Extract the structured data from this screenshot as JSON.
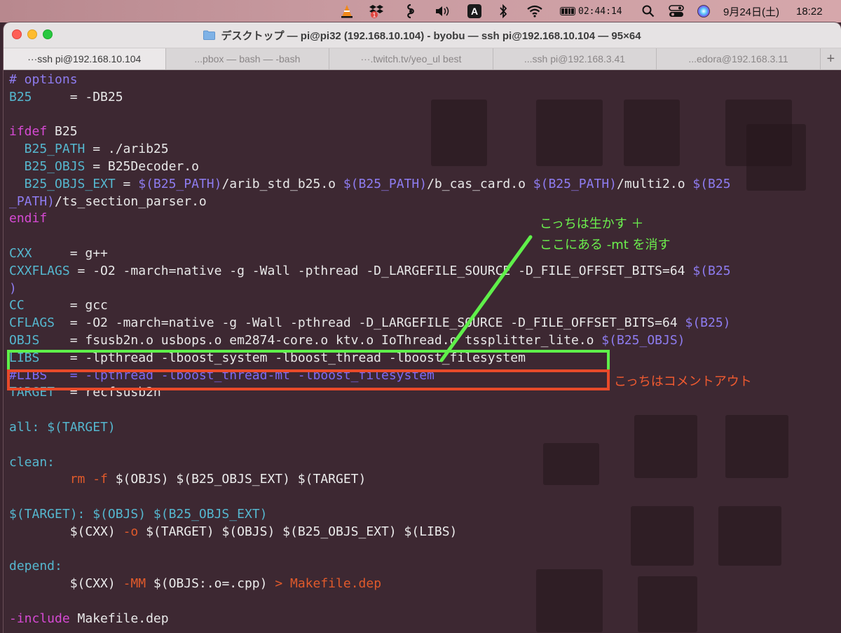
{
  "menubar": {
    "clock_timer": "02:44:14",
    "date": "9月24日(土)",
    "time": "18:22",
    "input_indicator": "A"
  },
  "window": {
    "title": "デスクトップ — pi@pi32 (192.168.10.104) - byobu — ssh pi@192.168.10.104 — 95×64",
    "tabs": [
      {
        "label": "···ssh pi@192.168.10.104",
        "active": true
      },
      {
        "label": "...pbox — bash — -bash",
        "active": false
      },
      {
        "label": "···.twitch.tv/yeo_ul best",
        "active": false
      },
      {
        "label": "...ssh pi@192.168.3.41",
        "active": false
      },
      {
        "label": "...edora@192.168.3.11",
        "active": false
      }
    ],
    "new_tab_label": "+"
  },
  "terminal": {
    "l01": {
      "a": "# options"
    },
    "l02": {
      "a": "B25",
      "b": "     = -DB25"
    },
    "l04": {
      "a": "ifdef",
      "b": " B25"
    },
    "l05": {
      "a": "  B25_PATH",
      "b": " = ./arib25"
    },
    "l06": {
      "a": "  B25_OBJS",
      "b": " = B25Decoder.o"
    },
    "l07": {
      "a": "  B25_OBJS_EXT",
      "b": " = ",
      "c": "$(B25_PATH)",
      "d": "/arib_std_b25.o ",
      "e": "$(B25_PATH)",
      "f": "/b_cas_card.o ",
      "g": "$(B25_PATH)",
      "h": "/multi2.o ",
      "i": "$(B25"
    },
    "l08": {
      "a": "_PATH)",
      "b": "/ts_section_parser.o"
    },
    "l09": {
      "a": "endif"
    },
    "l11": {
      "a": "CXX",
      "b": "     = g++"
    },
    "l12": {
      "a": "CXXFLAGS",
      "b": " = -O2 -march=native -g -Wall -pthread -D_LARGEFILE_SOURCE -D_FILE_OFFSET_BITS=64 ",
      "c": "$(B25"
    },
    "l13": {
      "a": ")"
    },
    "l14": {
      "a": "CC",
      "b": "      = gcc"
    },
    "l15": {
      "a": "CFLAGS",
      "b": "  = -O2 -march=native -g -Wall -pthread -D_LARGEFILE_SOURCE -D_FILE_OFFSET_BITS=64 ",
      "c": "$(B25)"
    },
    "l16": {
      "a": "OBJS",
      "b": "    = fsusb2n.o usbops.o em2874-core.o ktv.o IoThread.o tssplitter_lite.o ",
      "c": "$(B25_OBJS)"
    },
    "l17": {
      "a": "LIBS",
      "b": "    = -lpthread -lboost_system -lboost_thread -lboost_filesystem"
    },
    "l18": {
      "a": "#LIBS   = -lpthread -lboost_thread-mt -lboost_filesystem"
    },
    "l19": {
      "a": "TARGET",
      "b": "  = recfsusb2n"
    },
    "l21": {
      "a": "all: ",
      "b": "$(TARGET)"
    },
    "l23": {
      "a": "clean:"
    },
    "l24": {
      "a": "        rm -f ",
      "b": "$(OBJS) $(B25_OBJS_EXT) $(TARGET)"
    },
    "l26": {
      "a": "$(TARGET): $(OBJS) $(B25_OBJS_EXT)"
    },
    "l27": {
      "a": "        $(CXX) ",
      "b": "-o ",
      "c": "$(TARGET) $(OBJS) $(B25_OBJS_EXT) $(LIBS)"
    },
    "l29": {
      "a": "depend:"
    },
    "l30": {
      "a": "        $(CXX) ",
      "b": "-MM ",
      "c": "$(OBJS:.o=.cpp)",
      "d": " > Makefile.dep"
    },
    "l32": {
      "a": "-include",
      "b": " Makefile.dep"
    }
  },
  "annotations": {
    "green_note_line1": "こっちは生かす ＋",
    "green_note_line2": "ここにある -mt を消す",
    "red_note": "こっちはコメントアウト",
    "green_color": "#5ff04a",
    "red_color": "#e84a2a"
  }
}
